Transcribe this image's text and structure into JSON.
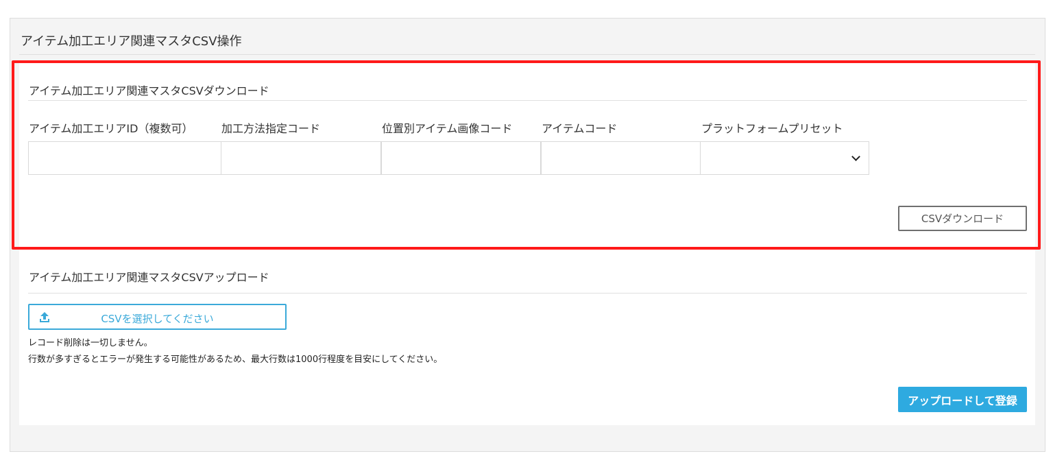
{
  "panel": {
    "title": "アイテム加工エリア関連マスタCSV操作"
  },
  "download": {
    "title": "アイテム加工エリア関連マスタCSVダウンロード",
    "fields": [
      {
        "label": "アイテム加工エリアID（複数可）",
        "value": ""
      },
      {
        "label": "加工方法指定コード",
        "value": ""
      },
      {
        "label": "位置別アイテム画像コード",
        "value": ""
      },
      {
        "label": "アイテムコード",
        "value": ""
      }
    ],
    "preset": {
      "label": "プラットフォームプリセット",
      "value": ""
    },
    "button_label": "CSVダウンロード"
  },
  "upload": {
    "title": "アイテム加工エリア関連マスタCSVアップロード",
    "file_button_label": "CSVを選択してください",
    "notes": [
      "レコード削除は一切しません。",
      "行数が多すぎるとエラーが発生する可能性があるため、最大行数は1000行程度を目安にしてください。"
    ],
    "submit_label": "アップロードして登録"
  },
  "icons": {
    "upload": "upload-icon",
    "select_caret": "chevron-down-icon"
  },
  "colors": {
    "highlight": "#ff1a1a",
    "primary": "#2eaae0",
    "file_button": "#3aa9d9"
  }
}
